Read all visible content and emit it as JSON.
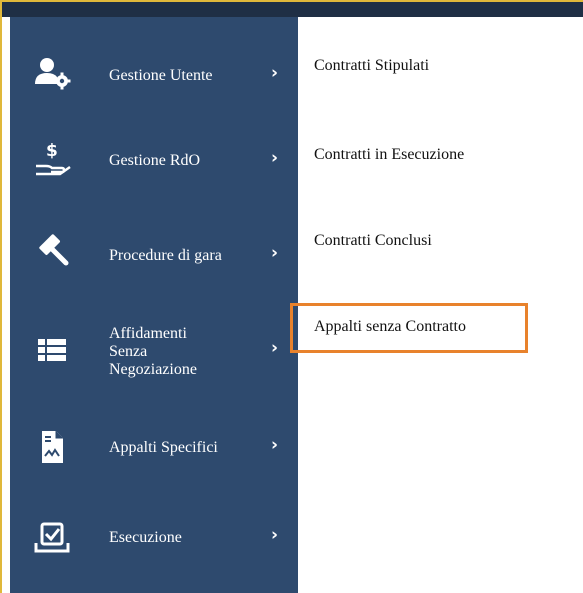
{
  "sidebar": {
    "items": [
      {
        "label": "Gestione Utente",
        "icon": "user-gear-icon"
      },
      {
        "label": "Gestione RdO",
        "icon": "dollar-hand-icon"
      },
      {
        "label": "Procedure di gara",
        "icon": "gavel-icon"
      },
      {
        "label": "Affidamenti\nSenza\nNegoziazione",
        "icon": "list-icon"
      },
      {
        "label": "Appalti Specifici",
        "icon": "document-chart-icon"
      },
      {
        "label": "Esecuzione",
        "icon": "checkbox-tray-icon"
      }
    ],
    "chevron": "›"
  },
  "submenu": {
    "items": [
      {
        "label": "Contratti Stipulati"
      },
      {
        "label": "Contratti in Esecuzione"
      },
      {
        "label": "Contratti Conclusi"
      },
      {
        "label": "Appalti senza Contratto"
      }
    ],
    "highlight_color": "#e8822c"
  },
  "colors": {
    "sidebar_bg": "#2e4a6e",
    "topbar_bg": "#1f2f45",
    "accent": "#e0b83a"
  }
}
